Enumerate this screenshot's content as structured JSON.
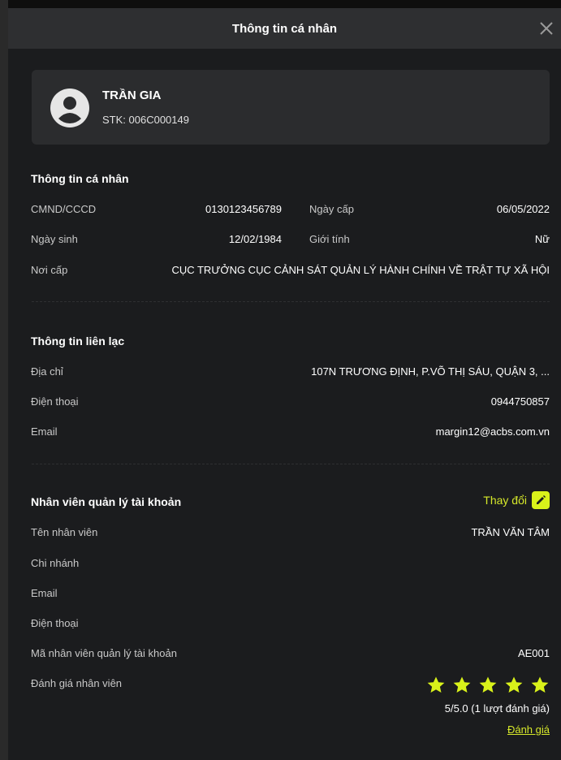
{
  "header": {
    "title": "Thông tin cá nhân"
  },
  "profile": {
    "name": "TRẦN GIA",
    "stk": "STK: 006C000149"
  },
  "personal": {
    "title": "Thông tin cá nhân",
    "id_label": "CMND/CCCD",
    "id_value": "0130123456789",
    "issue_date_label": "Ngày cấp",
    "issue_date_value": "06/05/2022",
    "dob_label": "Ngày sinh",
    "dob_value": "12/02/1984",
    "gender_label": "Giới tính",
    "gender_value": "Nữ",
    "issue_place_label": "Nơi cấp",
    "issue_place_value": "CỤC TRƯỞNG CỤC CẢNH SÁT QUẢN LÝ HÀNH CHÍNH VỀ TRẬT TỰ XÃ HỘI"
  },
  "contact": {
    "title": "Thông tin liên lạc",
    "address_label": "Địa chỉ",
    "address_value": "107N TRƯƠNG ĐỊNH, P.VÕ THỊ SÁU, QUẬN 3, ...",
    "phone_label": "Điện thoại",
    "phone_value": "0944750857",
    "email_label": "Email",
    "email_value": "margin12@acbs.com.vn"
  },
  "manager": {
    "title": "Nhân viên quản lý tài khoản",
    "change_label": "Thay đổi",
    "name_label": "Tên nhân viên",
    "name_value": "TRẦN VĂN TÂM",
    "branch_label": "Chi nhánh",
    "email_label": "Email",
    "phone_label": "Điện thoại",
    "code_label": "Mã nhân viên quản lý tài khoản",
    "code_value": "AE001",
    "rating_label": "Đánh giá nhân viên",
    "rating_stars": 5,
    "rating_text": "5/5.0 (1 lượt đánh giá)",
    "rate_link": "Đánh giá"
  },
  "colors": {
    "accent": "#d6e82a",
    "background": "#1b1c1e",
    "header": "#2e2f31",
    "card": "#2b2c2e"
  }
}
